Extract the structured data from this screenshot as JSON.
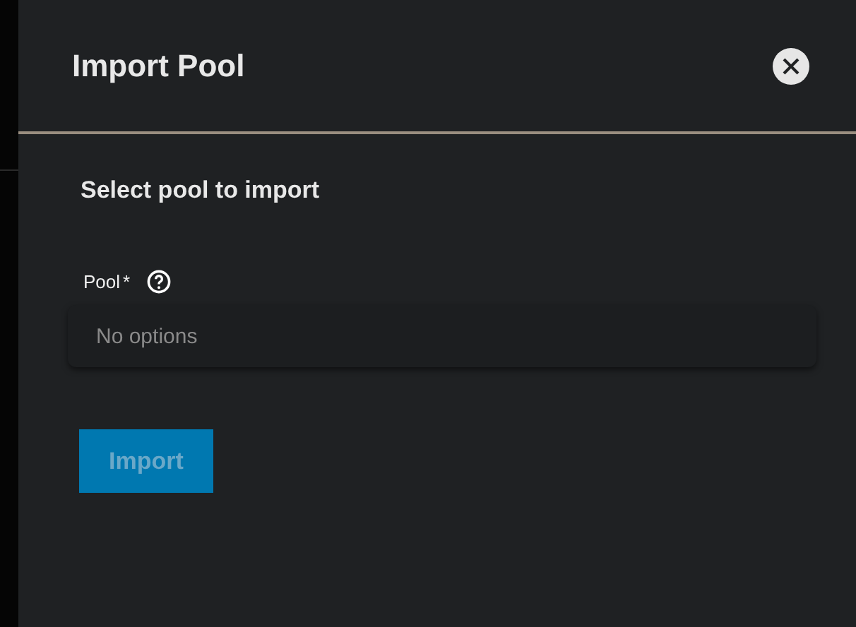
{
  "dialog": {
    "title": "Import Pool",
    "subtitle": "Select pool to import",
    "field": {
      "label": "Pool",
      "required_mark": "*",
      "placeholder": "No options"
    },
    "button": {
      "label": "Import",
      "disabled": true
    }
  }
}
